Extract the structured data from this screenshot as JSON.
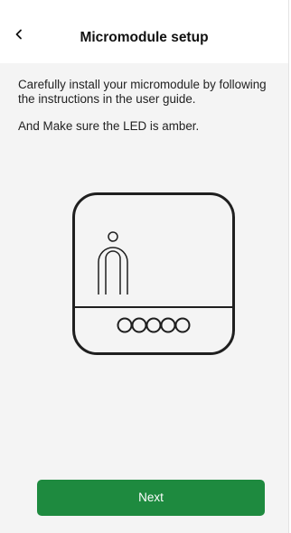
{
  "header": {
    "back_icon": "chevron-left-icon",
    "title": "Micromodule setup"
  },
  "content": {
    "paragraph_1": "Carefully install your micromodule by following the instructions in the user guide.",
    "paragraph_2": "And Make sure the LED is amber."
  },
  "illustration": {
    "icon": "micromodule-device-icon",
    "terminal_count": 5
  },
  "footer": {
    "next_label": "Next"
  },
  "colors": {
    "accent": "#1e8a3f",
    "background": "#f4f4f4",
    "header_background": "#ffffff"
  }
}
